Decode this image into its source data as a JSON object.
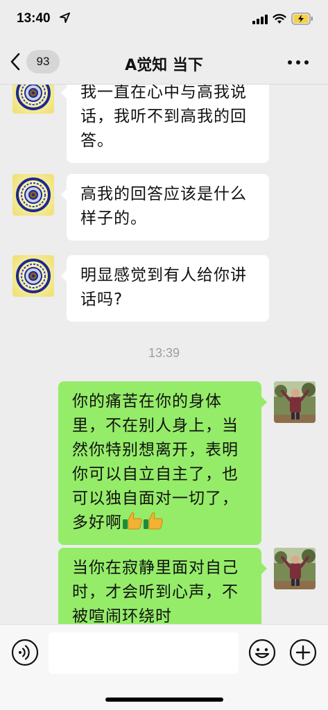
{
  "status_bar": {
    "time": "13:40",
    "location_icon": "location-arrow-icon",
    "signal_icon": "cellular-signal-icon",
    "wifi_icon": "wifi-icon",
    "battery_icon": "battery-charging-icon",
    "battery_color": "#f7d046"
  },
  "nav": {
    "back_icon": "chevron-left-icon",
    "unread_count": "93",
    "title": "A觉知 当下",
    "more_icon": "more-dots-icon"
  },
  "messages": [
    {
      "side": "in",
      "avatar": "mandala-avatar",
      "text": "我一直在心中与高我说话，我听不到高我的回答。"
    },
    {
      "side": "in",
      "avatar": "mandala-avatar",
      "text": "高我的回答应该是什么样子的。"
    },
    {
      "side": "in",
      "avatar": "mandala-avatar",
      "text": "明显感觉到有人给你讲话吗?"
    },
    {
      "type": "timestamp",
      "text": "13:39"
    },
    {
      "side": "out",
      "avatar": "man-outdoor-avatar",
      "text": "你的痛苦在你的身体里，不在别人身上，当然你特别想离开，表明你可以自立自主了，也可以独自面对一切了，多好啊",
      "emoji": [
        "thumbs-up-emoji",
        "thumbs-up-emoji"
      ]
    },
    {
      "side": "out",
      "avatar": "man-outdoor-avatar",
      "text": "当你在寂静里面对自己时，才会听到心声，不被喧闹环绕时"
    }
  ],
  "input_bar": {
    "voice_icon": "voice-icon",
    "input_value": "",
    "emoji_icon": "emoji-face-icon",
    "plus_icon": "plus-circle-icon"
  },
  "colors": {
    "background": "#ededed",
    "incoming_bubble": "#ffffff",
    "outgoing_bubble": "#95ec69",
    "timestamp_text": "#9e9e9e"
  }
}
